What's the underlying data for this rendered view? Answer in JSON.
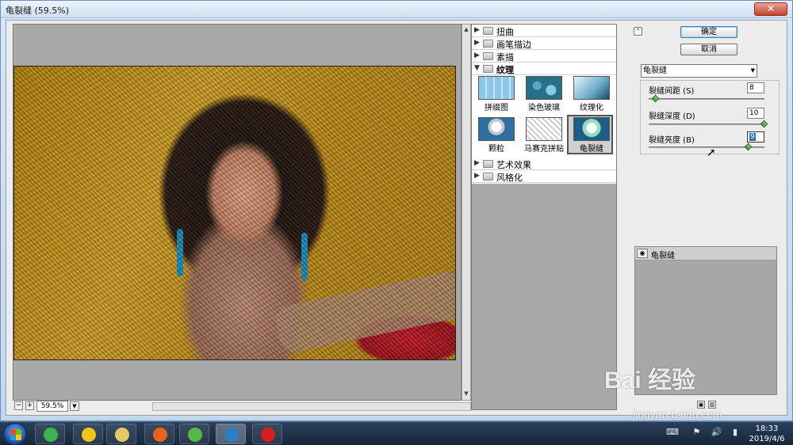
{
  "window": {
    "title": "龟裂缝 (59.5%)",
    "close_symbol": "✕"
  },
  "preview": {
    "zoom": "59.5%",
    "zoom_minus": "−",
    "zoom_plus": "+"
  },
  "gallery": {
    "categories": [
      {
        "label": "扭曲"
      },
      {
        "label": "画笔描边"
      },
      {
        "label": "素描"
      },
      {
        "label": "纹理"
      },
      {
        "label": "艺术效果"
      },
      {
        "label": "风格化"
      }
    ],
    "thumbnails": [
      {
        "label": "拼缀图"
      },
      {
        "label": "染色玻璃"
      },
      {
        "label": "纹理化"
      },
      {
        "label": "颗粒"
      },
      {
        "label": "马赛克拼贴"
      },
      {
        "label": "龟裂缝",
        "selected": true
      }
    ]
  },
  "buttons": {
    "ok": "确定",
    "cancel": "取消"
  },
  "filter_select": {
    "value": "龟裂缝"
  },
  "params": [
    {
      "label": "裂缝间距 (S)",
      "value": "8",
      "fraction": 0.06
    },
    {
      "label": "裂缝深度 (D)",
      "value": "10",
      "fraction": 1.0
    },
    {
      "label": "裂缝亮度 (B)",
      "value": "9",
      "fraction": 0.86
    }
  ],
  "layers": [
    {
      "label": "龟裂缝"
    }
  ],
  "watermark": {
    "big": "Bai 经验",
    "small": "jingyan.baidu.com"
  },
  "taskbar": {
    "clock_time": "18:33",
    "clock_date": "2019/4/6",
    "apps": [
      {
        "name": "360-icon",
        "color": "#3fb34f"
      },
      {
        "name": "qq-icon",
        "color": "#f2c318"
      },
      {
        "name": "file-explorer-icon",
        "color": "#e7c56b"
      },
      {
        "name": "firefox-icon",
        "color": "#e8621a"
      },
      {
        "name": "media-player-icon",
        "color": "#55b948"
      },
      {
        "name": "photoshop-icon",
        "color": "#2d7fc2"
      },
      {
        "name": "record-icon",
        "color": "#d81e1e"
      }
    ]
  },
  "colors": {
    "accent": "#2d6fc0",
    "slider_knob": "#2f9a2a"
  }
}
